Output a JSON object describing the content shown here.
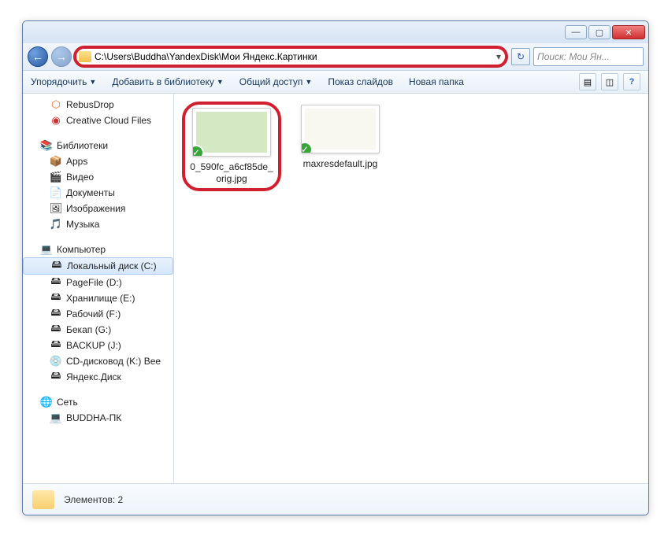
{
  "titlebar": {
    "min": "—",
    "max": "▢",
    "close": "✕"
  },
  "nav": {
    "back": "←",
    "fwd": "→",
    "drop": "▾",
    "refresh": "↻"
  },
  "address": {
    "path": "C:\\Users\\Buddha\\YandexDisk\\Мои Яндекс.Картинки"
  },
  "search": {
    "placeholder": "Поиск: Мои Ян..."
  },
  "toolbar": {
    "organize": "Упорядочить",
    "library": "Добавить в библиотеку",
    "share": "Общий доступ",
    "slideshow": "Показ слайдов",
    "newfolder": "Новая папка"
  },
  "tree": {
    "rebusdrop": "RebusDrop",
    "ccfiles": "Creative Cloud Files",
    "libraries": "Библиотеки",
    "apps": "Apps",
    "video": "Видео",
    "documents": "Документы",
    "images": "Изображения",
    "music": "Музыка",
    "computer": "Компьютер",
    "localc": "Локальный диск (C:)",
    "pagefile": "PageFile (D:)",
    "storage": "Хранилище (E:)",
    "work": "Рабочий (F:)",
    "backup_g": "Бекап (G:)",
    "backup_j": "BACKUP (J:)",
    "cd": "CD-дисковод (K:) Bee",
    "yadisk": "Яндекс.Диск",
    "network": "Сеть",
    "buddha": "BUDDHA-ПК"
  },
  "files": [
    {
      "name": "0_590fc_a6cf85de_orig.jpg",
      "style": "green"
    },
    {
      "name": "maxresdefault.jpg",
      "style": "white"
    }
  ],
  "status": {
    "text": "Элементов: 2"
  },
  "icons": {
    "expand": "▹",
    "collapse": "▿",
    "folder": "📁",
    "net": "🌐",
    "pc": "💻",
    "drive": "🖴",
    "cd": "💿",
    "lib": "📚",
    "media": "🎵",
    "doc": "📄",
    "img": "🖼",
    "app": "📦",
    "help": "?",
    "view": "▤"
  }
}
